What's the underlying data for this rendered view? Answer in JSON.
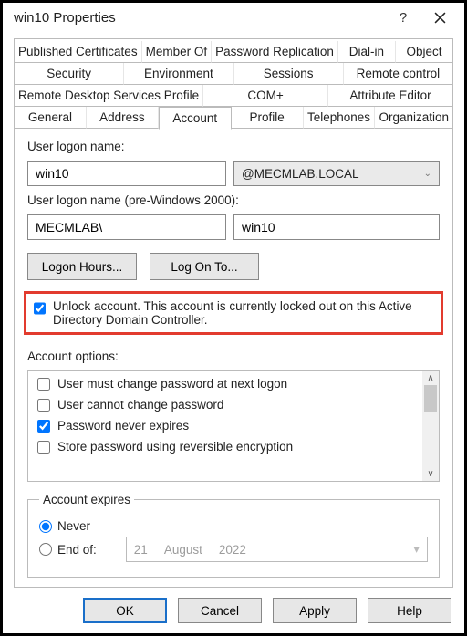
{
  "title": "win10 Properties",
  "tabs": {
    "row1": [
      "Published Certificates",
      "Member Of",
      "Password Replication",
      "Dial-in",
      "Object"
    ],
    "row2": [
      "Security",
      "Environment",
      "Sessions",
      "Remote control"
    ],
    "row3": [
      "Remote Desktop Services Profile",
      "COM+",
      "Attribute Editor"
    ],
    "row4": [
      "General",
      "Address",
      "Account",
      "Profile",
      "Telephones",
      "Organization"
    ],
    "active": "Account"
  },
  "logon": {
    "label": "User logon name:",
    "value": "win10",
    "domain": "@MECMLAB.LOCAL"
  },
  "pre2000": {
    "label": "User logon name (pre-Windows 2000):",
    "domain": "MECMLAB\\",
    "value": "win10"
  },
  "buttons": {
    "logon_hours": "Logon Hours...",
    "log_on_to": "Log On To..."
  },
  "unlock": {
    "checked": true,
    "text": "Unlock account. This account is currently locked out on this Active Directory Domain Controller."
  },
  "options": {
    "title": "Account options:",
    "items": [
      {
        "label": "User must change password at next logon",
        "checked": false
      },
      {
        "label": "User cannot change password",
        "checked": false
      },
      {
        "label": "Password never expires",
        "checked": true
      },
      {
        "label": "Store password using reversible encryption",
        "checked": false
      }
    ]
  },
  "expires": {
    "legend": "Account expires",
    "never_label": "Never",
    "endof_label": "End of:",
    "selected": "never",
    "date": {
      "day": "21",
      "month": "August",
      "year": "2022"
    }
  },
  "footer": {
    "ok": "OK",
    "cancel": "Cancel",
    "apply": "Apply",
    "help": "Help"
  }
}
